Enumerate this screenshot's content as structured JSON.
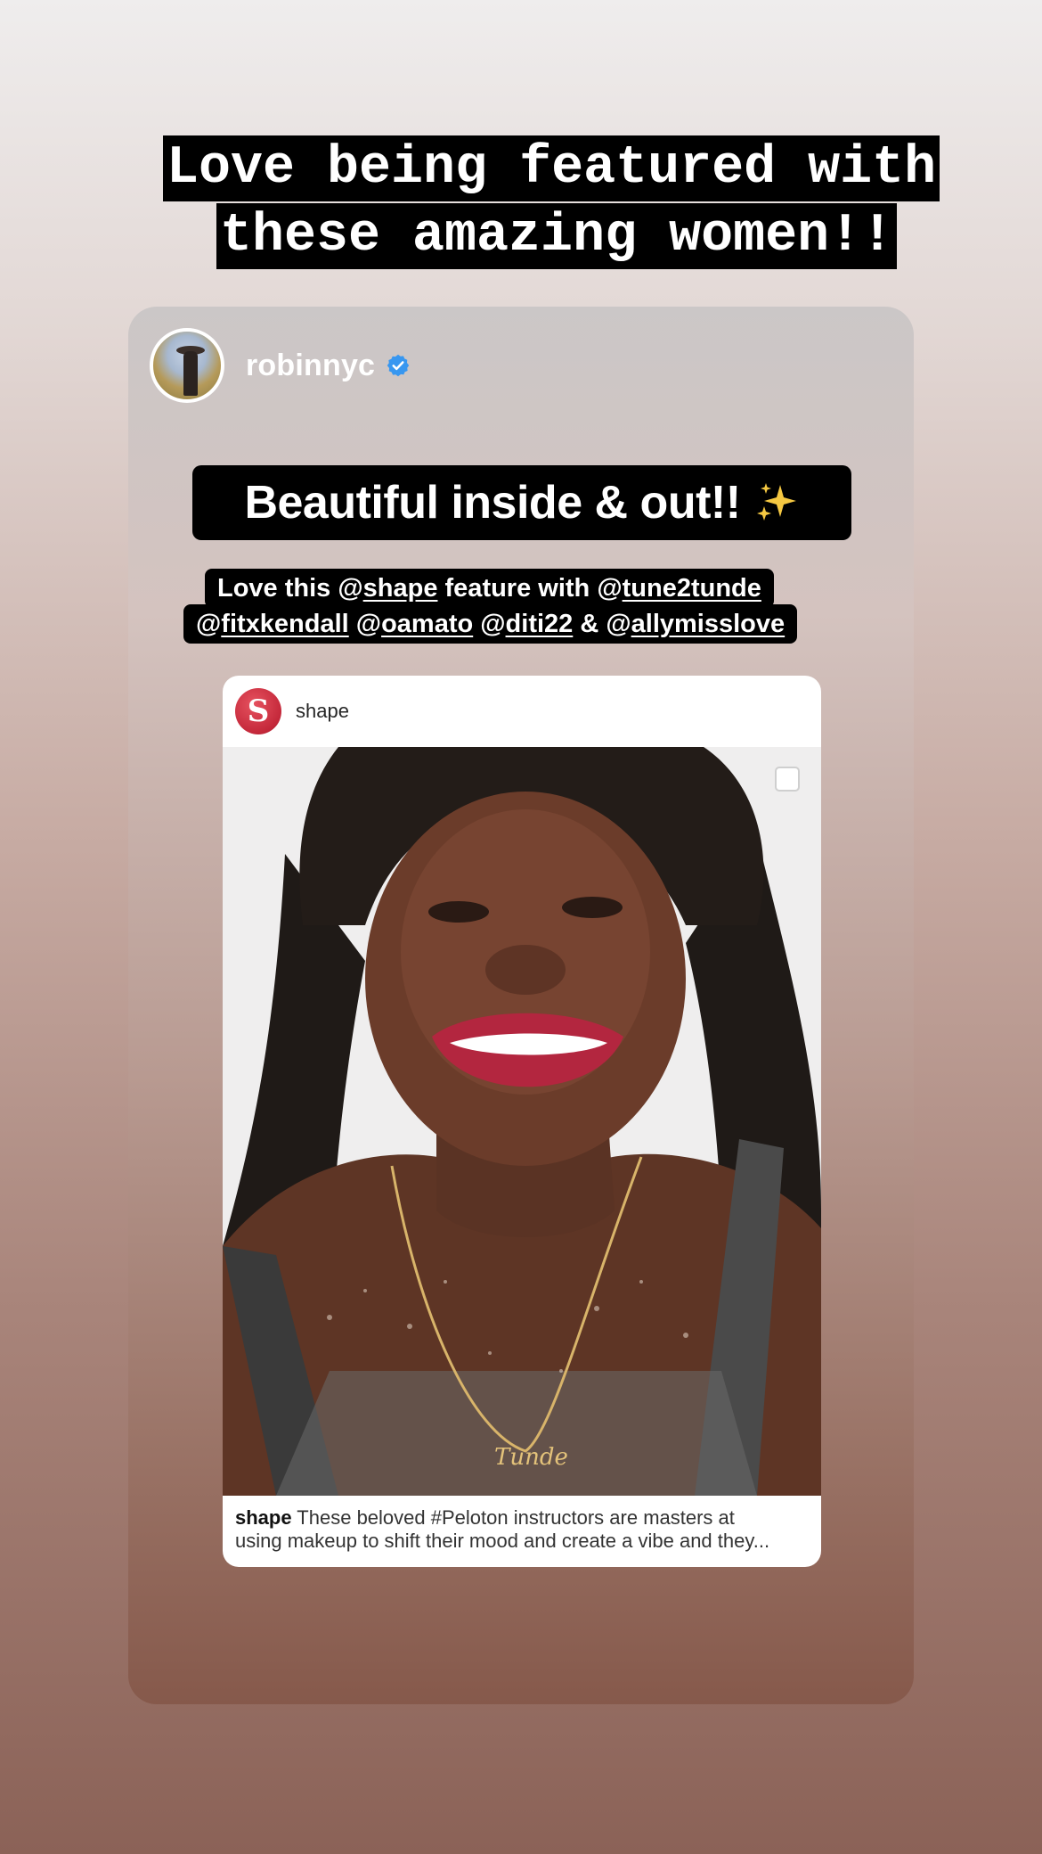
{
  "story": {
    "caption_line1": "Love being featured with",
    "caption_line2": "these amazing women!!"
  },
  "shared_post": {
    "username": "robinnyc",
    "verified": true,
    "headline": "Beautiful inside & out!!",
    "headline_emoji": "sparkles-icon",
    "desc": {
      "t1": "Love this @",
      "m1": "shape",
      "t2": " feature with @",
      "m2": "tune2tunde",
      "t3": "@",
      "m3": "fitxkendall",
      "t4": " @",
      "m4": "oamato",
      "t5": " @",
      "m5": "diti22",
      "t6": " & @",
      "m6": "allymisslove"
    }
  },
  "embedded_post": {
    "handle": "shape",
    "logo_letter": "S",
    "caption_handle": "shape",
    "caption_line1": " These beloved #Peloton instructors are masters at",
    "caption_line2": "using makeup to shift their mood and create a vibe and they...",
    "necklace_text": "Tunde"
  },
  "colors": {
    "verified_blue": "#3897f0",
    "shape_red": "#c4283a"
  }
}
